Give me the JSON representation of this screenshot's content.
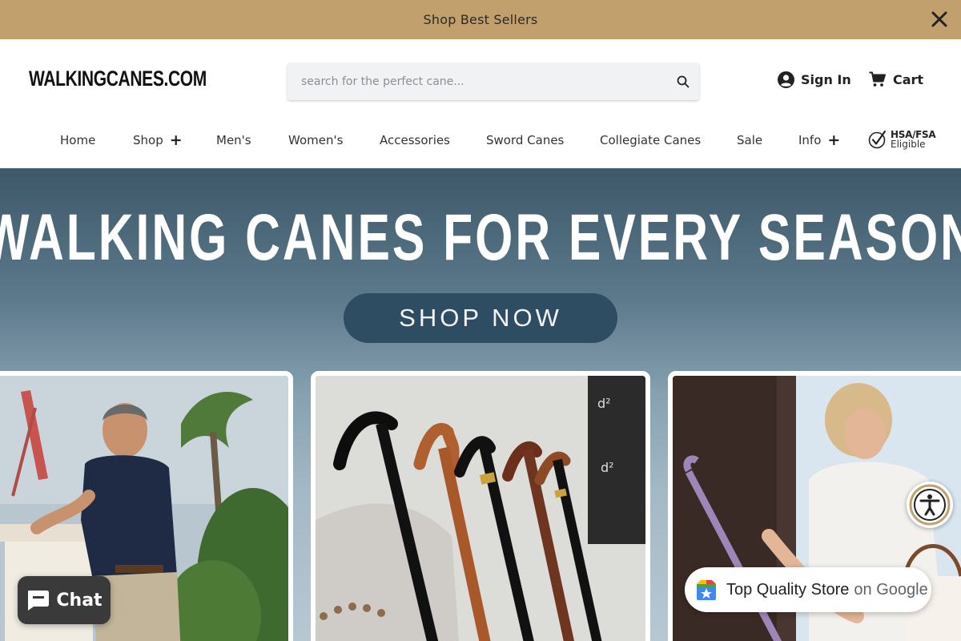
{
  "announcement": {
    "text": "Shop Best Sellers"
  },
  "header": {
    "logo": "WALKINGCANES.COM",
    "search_placeholder": "search for the perfect cane...",
    "sign_in": "Sign In",
    "cart": "Cart"
  },
  "nav": {
    "items": [
      {
        "label": "Home"
      },
      {
        "label": "Shop"
      },
      {
        "label": "Men's"
      },
      {
        "label": "Women's"
      },
      {
        "label": "Accessories"
      },
      {
        "label": "Sword Canes"
      },
      {
        "label": "Collegiate Canes"
      },
      {
        "label": "Sale"
      },
      {
        "label": "Info"
      }
    ],
    "hsa_line1": "HSA/FSA",
    "hsa_line2": "Eligible"
  },
  "hero": {
    "title": "WALKING CANES FOR EVERY SEASON",
    "button": "SHOP NOW"
  },
  "widgets": {
    "chat": "Chat",
    "google_strong": "Top Quality Store",
    "google_light": "on Google"
  },
  "colors": {
    "announcement_bg": "#c1a06e",
    "hero_button": "#2f4d62",
    "chat_bg": "#3a3a3a",
    "accessibility_ring": "#c1a06e"
  },
  "icons": [
    "close-icon",
    "search-icon",
    "user-icon",
    "cart-icon",
    "plus-icon",
    "checkmark-icon",
    "chat-bubble-icon",
    "accessibility-icon",
    "google-shopping-icon"
  ]
}
